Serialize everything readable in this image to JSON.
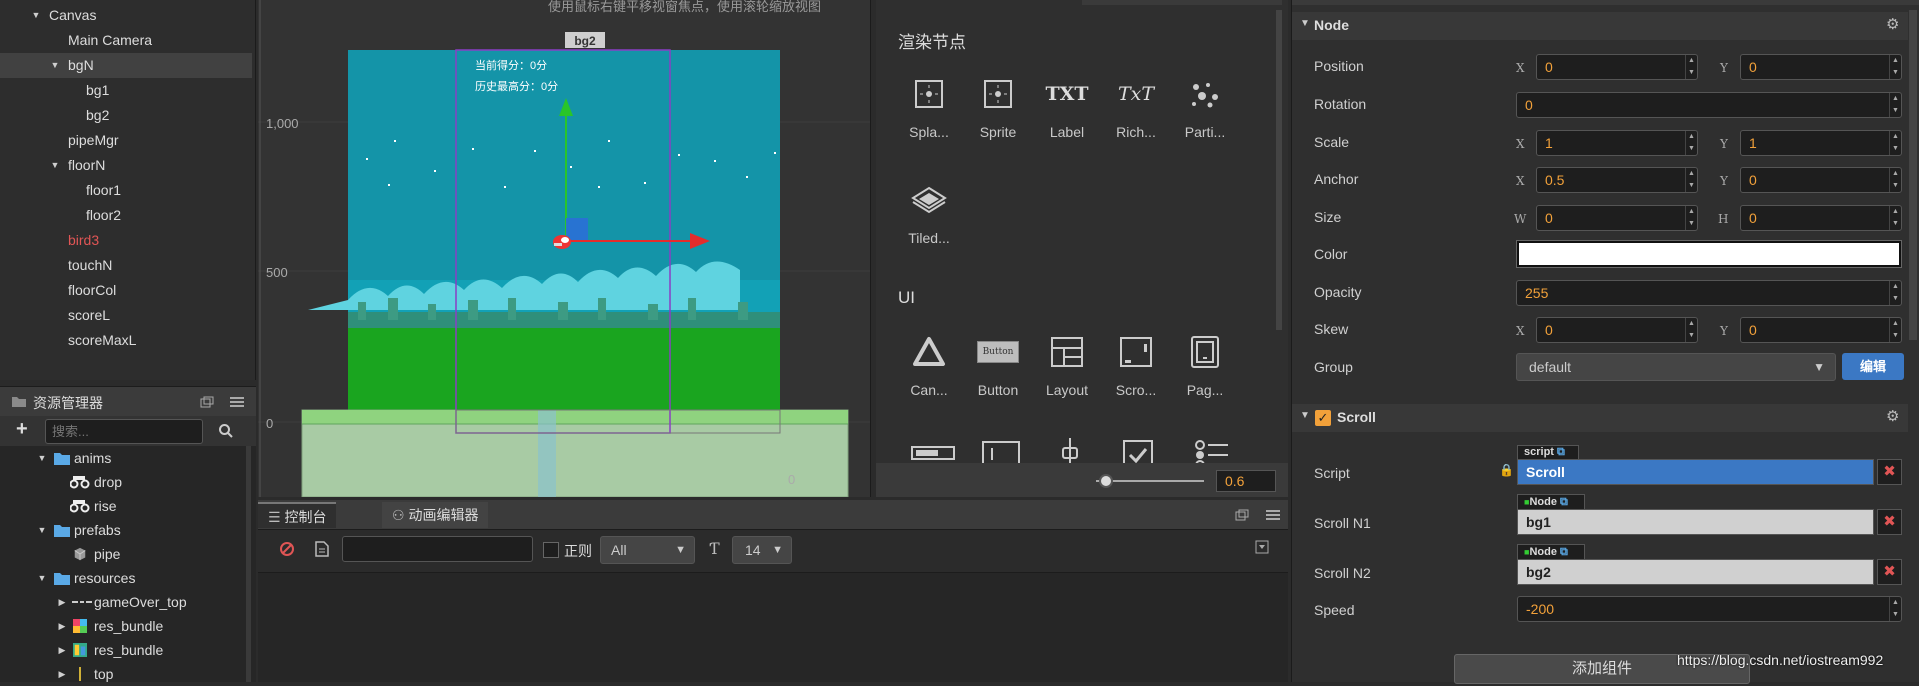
{
  "hierarchy": {
    "items": [
      {
        "label": "Canvas"
      },
      {
        "label": "Main Camera"
      },
      {
        "label": "bgN"
      },
      {
        "label": "bg1"
      },
      {
        "label": "bg2"
      },
      {
        "label": "pipeMgr"
      },
      {
        "label": "floorN"
      },
      {
        "label": "floor1"
      },
      {
        "label": "floor2"
      },
      {
        "label": "bird3"
      },
      {
        "label": "touchN"
      },
      {
        "label": "floorCol"
      },
      {
        "label": "scoreL"
      },
      {
        "label": "scoreMaxL"
      }
    ]
  },
  "assets": {
    "title": "资源管理器",
    "search_placeholder": "搜索...",
    "add_label": "+",
    "items": [
      {
        "label": "anims"
      },
      {
        "label": "drop"
      },
      {
        "label": "rise"
      },
      {
        "label": "prefabs"
      },
      {
        "label": "pipe"
      },
      {
        "label": "resources"
      },
      {
        "label": "gameOver_top"
      },
      {
        "label": "res_bundle"
      },
      {
        "label": "res_bundle"
      },
      {
        "label": "top"
      }
    ]
  },
  "scene": {
    "hint": "使用鼠标右键平移视窗焦点，使用滚轮缩放视图",
    "node_tag": "bg2",
    "axis_labels": [
      "1,000",
      "500",
      "0"
    ],
    "score_line": "当前得分：0分",
    "max_line": "历史最高分：0分",
    "bottom_partial": "0"
  },
  "library": {
    "section1": "渲染节点",
    "section2": "UI",
    "render_items": [
      {
        "label": "Spla...",
        "icon": "splash-icon"
      },
      {
        "label": "Sprite",
        "icon": "sprite-icon"
      },
      {
        "label": "Label",
        "icon": "label-icon",
        "glyph": "TXT"
      },
      {
        "label": "Rich...",
        "icon": "richtext-icon",
        "glyph": "TxT"
      },
      {
        "label": "Parti...",
        "icon": "particle-icon"
      },
      {
        "label": "Tiled...",
        "icon": "tiledmap-icon"
      }
    ],
    "ui_items": [
      {
        "label": "Can...",
        "icon": "canvas-icon"
      },
      {
        "label": "Button",
        "icon": "button-icon",
        "glyph": "Button"
      },
      {
        "label": "Layout",
        "icon": "layout-icon"
      },
      {
        "label": "Scro...",
        "icon": "scrollview-icon"
      },
      {
        "label": "Pag...",
        "icon": "pageview-icon"
      }
    ],
    "zoom": "0.6",
    "zoom_level": 0.6
  },
  "console": {
    "tab_console": "控制台",
    "tab_anim": "动画编辑器",
    "regex_label": "正则",
    "filter_value": "All",
    "font_size_value": "14"
  },
  "inspector": {
    "node_title": "Node",
    "position": {
      "label": "Position",
      "x": "0",
      "y": "0"
    },
    "rotation": {
      "label": "Rotation",
      "value": "0"
    },
    "scale": {
      "label": "Scale",
      "x": "1",
      "y": "1"
    },
    "anchor": {
      "label": "Anchor",
      "x": "0.5",
      "y": "0"
    },
    "size": {
      "label": "Size",
      "w": "0",
      "h": "0"
    },
    "color": {
      "label": "Color",
      "value": "#ffffff"
    },
    "opacity": {
      "label": "Opacity",
      "value": "255"
    },
    "skew": {
      "label": "Skew",
      "x": "0",
      "y": "0"
    },
    "group": {
      "label": "Group",
      "value": "default",
      "edit_label": "编辑"
    },
    "axis": {
      "x": "X",
      "y": "Y",
      "w": "W",
      "h": "H"
    },
    "scroll_title": "Scroll",
    "script": {
      "label": "Script",
      "tag": "script",
      "value": "Scroll"
    },
    "scroll_n1": {
      "label": "Scroll N1",
      "tag": "Node",
      "value": "bg1"
    },
    "scroll_n2": {
      "label": "Scroll N2",
      "tag": "Node",
      "value": "bg2"
    },
    "speed": {
      "label": "Speed",
      "value": "-200"
    },
    "add_component": "添加组件",
    "watermark": "https://blog.csdn.net/iostream992"
  },
  "colors": {
    "accent_orange": "#f2a13a",
    "selection_blue": "#3b78c4",
    "error_red": "#e05555",
    "panel": "#2f2f2f"
  }
}
